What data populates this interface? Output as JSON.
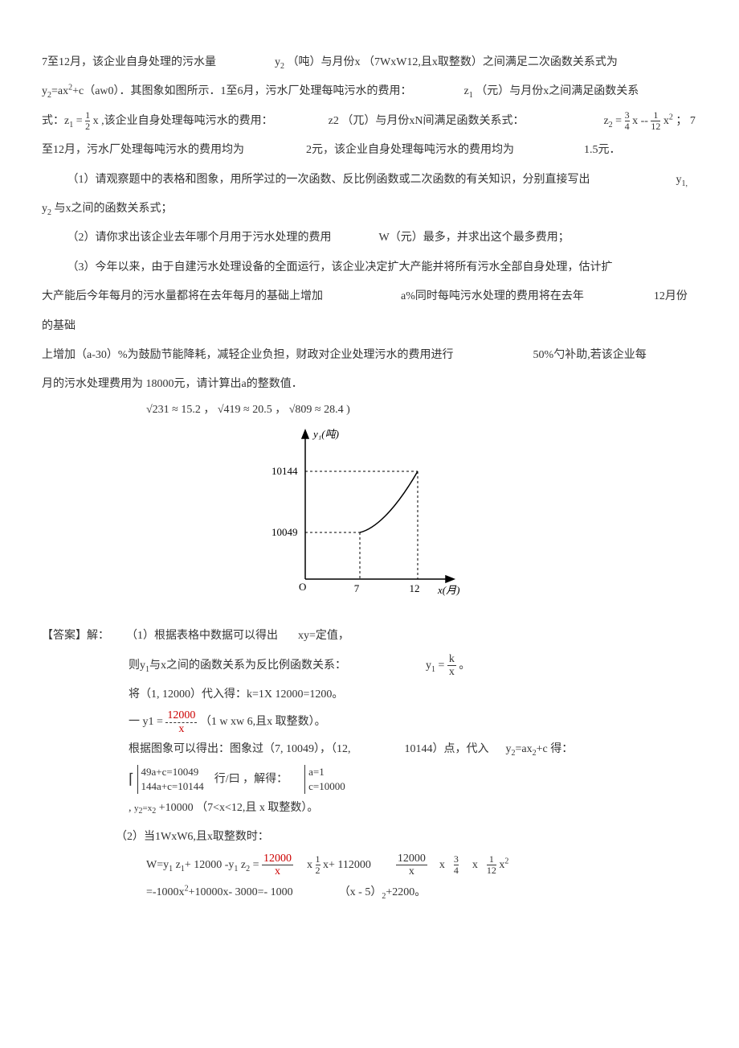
{
  "p1_a": "7至12月，该企业自身处理的污水量",
  "p1_b": "y",
  "p1_b_sub": "2",
  "p1_c": "（吨）与月份x （7WxW12,且x取整数）之间满足二次函数关系式为",
  "p2_a": "y",
  "p2_a_sub": "2",
  "p2_b": "=ax",
  "p2_b_sup": "2",
  "p2_c": "+c（aw0）．其图象如图所示．1至6月，污水厂处理每吨污水的费用：",
  "p2_d": "z",
  "p2_d_sub": "1",
  "p2_e": "（元）与月份x之间满足函数关系",
  "p3_a": "式：z",
  "p3_a_sub": "1",
  "p3_b": " =",
  "p3_frac1_top": "1",
  "p3_frac1_bot": "2",
  "p3_c": "x ,该企业自身处理每吨污水的费用：",
  "p3_d": "z2 （兀）与月份xN间满足函数关系式：",
  "p3_e": "z",
  "p3_e_sub": "2",
  "p3_f": " = ",
  "p3_frac2_top": "3",
  "p3_frac2_bot": "4",
  "p3_g": " x --",
  "p3_frac3_top": "1",
  "p3_frac3_bot": "12",
  "p3_h": " x",
  "p3_h_sup": "2",
  "p3_i": " ； 7",
  "p4_a": "至12月，污水厂处理每吨污水的费用均为",
  "p4_b": "2元，该企业自身处理每吨污水的费用均为",
  "p4_c": "1.5元．",
  "p5_a": "（1）请观察题中的表格和图象，用所学过的一次函数、反比例函数或二次函数的有关知识，分别直接写出",
  "p5_b": "y",
  "p5_b_sub": "1,",
  "p6_a": "y",
  "p6_a_sub": "2",
  "p6_b": "与x之间的函数关系式；",
  "p7_a": "（2）请你求出该企业去年哪个月用于污水处理的费用",
  "p7_b": "W（元）最多，并求出这个最多费用；",
  "p8": "（3）今年以来，由于自建污水处理设备的全面运行，该企业决定扩大产能并将所有污水全部自身处理，估计扩",
  "p9_a": "大产能后今年每月的污水量都将在去年每月的基础上增加",
  "p9_b": "a%同时每吨污水处理的费用将在去年",
  "p9_c": "12月份的基础",
  "p10_a": "上增加（a-30）%为鼓励节能降耗，减轻企业负担，财政对企业处理污水的费用进行",
  "p10_b": "50%勺补助,若该企业每",
  "p11": "月的污水处理费用为 18000元，请计算出a的整数值．",
  "radicals": "√231 ≈ 15.2 ，  √419 ≈ 20.5 ， √809 ≈ 28.4 )",
  "chart_data": {
    "type": "line",
    "ylabel": "y₁(吨)",
    "xlabel": "x(月)",
    "x": [
      7,
      12
    ],
    "y": [
      10049,
      10144
    ],
    "origin": "O",
    "yticks": [
      10049,
      10144
    ],
    "xticks": [
      7,
      12
    ]
  },
  "ans_label": "【答案】解：",
  "a1_a": "（1）根据表格中数据可以得出",
  "a1_b": "xy=定值，",
  "a2_a": "则y",
  "a2_a_sub": "1",
  "a2_b": "与x之间的函数关系为反比例函数关系：",
  "a2_c": "y",
  "a2_c_sub": "1",
  "a2_d": " =",
  "a2_frac_top": "k",
  "a2_frac_bot": "x",
  "a2_e": "。",
  "a3": "将（1, 12000）代入得：k=1X 12000=1200。",
  "a4_a": "一 y1 =",
  "a4_frac_top": "12000",
  "a4_frac_bot": "x",
  "a4_b": "（1 w xw 6,且x 取整数）。",
  "a5_a": "根据图象可以得出：图象过（7, 10049），（12,",
  "a5_b": "10144）点，代入",
  "a5_c": "y",
  "a5_c_sub": "2",
  "a5_d": "=ax",
  "a5_d_sub": "2",
  "a5_e": "+c 得：",
  "a6_l1": "49a+c=10049",
  "a6_l2": "144a+c=10144",
  "a6_mid": "行/曰  ，解得：",
  "a6_r1": "a=1",
  "a6_r2": "c=10000",
  "a7_a": ",",
  "a7_b": "y",
  "a7_b_sub": "2",
  "a7_c": "=x",
  "a7_c_sub": "2",
  "a7_d": "+10000 （7<x<12,且 x 取整数）。",
  "a8": "（2）当1WxW6,且x取整数时：",
  "a9_a": "W=y",
  "a9_a_sub": "1",
  "a9_b": " z",
  "a9_b_sub": "1",
  "a9_c": "+ 12000 -y",
  "a9_c_sub": "1",
  "a9_d": " z",
  "a9_d_sub": "2",
  "a9_e": " =",
  "a9_fr1_top": "12000",
  "a9_fr1_bot": "x",
  "a9_f": "x",
  "a9_fr2_top": "1",
  "a9_fr2_bot": "2",
  "a9_g": "x+ 112000",
  "a9_fr3_top": "12000",
  "a9_fr3_bot": "x",
  "a9_h": "x",
  "a9_fr4_top": "3",
  "a9_fr4_bot": "4",
  "a9_i": "x",
  "a9_fr5_top": "1",
  "a9_fr5_bot": "12",
  "a9_j": "x",
  "a9_j_sup": "2",
  "a10_a": "=-1000x",
  "a10_a_sup": "2",
  "a10_b": "+10000x- 3000=- 1000",
  "a10_c": "（x - 5）",
  "a10_c_sub": "2",
  "a10_d": "+2200。"
}
